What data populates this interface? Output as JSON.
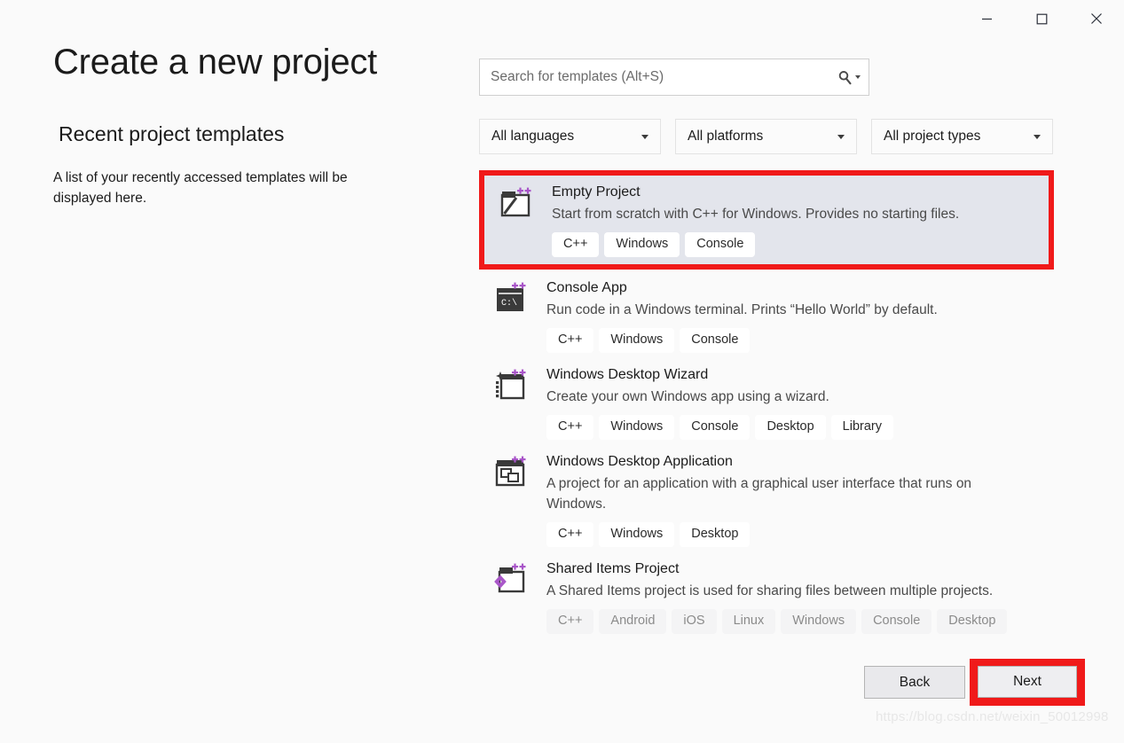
{
  "window": {
    "controls": [
      {
        "name": "minimize",
        "glyph": "minimize-icon"
      },
      {
        "name": "maximize",
        "glyph": "maximize-icon"
      },
      {
        "name": "close",
        "glyph": "close-icon"
      }
    ]
  },
  "left": {
    "title": "Create a new project",
    "recent_heading": "Recent project templates",
    "recent_description": "A list of your recently accessed templates will be displayed here."
  },
  "search": {
    "placeholder": "Search for templates (Alt+S)",
    "value": "",
    "icon": "search-icon"
  },
  "filters": [
    {
      "label": "All languages",
      "icon": "chevron-down-icon"
    },
    {
      "label": "All platforms",
      "icon": "chevron-down-icon"
    },
    {
      "label": "All project types",
      "icon": "chevron-down-icon"
    }
  ],
  "templates": [
    {
      "name": "Empty Project",
      "description": "Start from scratch with C++ for Windows. Provides no starting files.",
      "tags": [
        "C++",
        "Windows",
        "Console"
      ],
      "selected": true,
      "icon": "empty-project-icon",
      "muted_tags": false
    },
    {
      "name": "Console App",
      "description": "Run code in a Windows terminal. Prints “Hello World” by default.",
      "tags": [
        "C++",
        "Windows",
        "Console"
      ],
      "selected": false,
      "icon": "console-app-icon",
      "muted_tags": false
    },
    {
      "name": "Windows Desktop Wizard",
      "description": "Create your own Windows app using a wizard.",
      "tags": [
        "C++",
        "Windows",
        "Console",
        "Desktop",
        "Library"
      ],
      "selected": false,
      "icon": "desktop-wizard-icon",
      "muted_tags": false
    },
    {
      "name": "Windows Desktop Application",
      "description": "A project for an application with a graphical user interface that runs on Windows.",
      "tags": [
        "C++",
        "Windows",
        "Desktop"
      ],
      "selected": false,
      "icon": "desktop-application-icon",
      "muted_tags": false
    },
    {
      "name": "Shared Items Project",
      "description": "A Shared Items project is used for sharing files between multiple projects.",
      "tags": [
        "C++",
        "Android",
        "iOS",
        "Linux",
        "Windows",
        "Console",
        "Desktop"
      ],
      "selected": false,
      "icon": "shared-items-icon",
      "muted_tags": true
    }
  ],
  "footer": {
    "back_label": "Back",
    "next_label": "Next"
  },
  "watermark": "https://blog.csdn.net/weixin_50012998",
  "colors": {
    "highlight_red": "#f01a1a",
    "selected_row_bg": "#e3e5ec",
    "page_bg": "#fafafa",
    "accent_purple": "#a855c8"
  }
}
